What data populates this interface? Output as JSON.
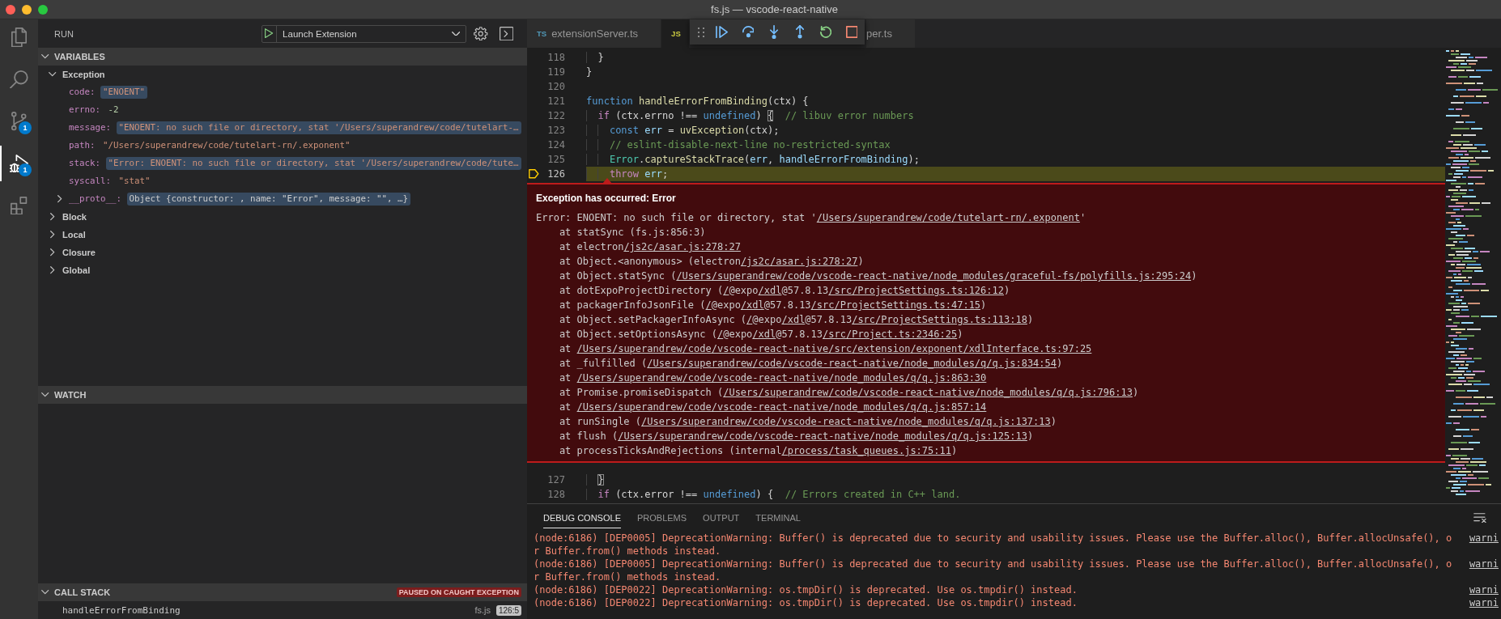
{
  "window": {
    "title": "fs.js — vscode-react-native"
  },
  "activity_bar": {
    "items": [
      {
        "kind": "explorer",
        "selected": false
      },
      {
        "kind": "search",
        "selected": false
      },
      {
        "kind": "source-control",
        "selected": false,
        "badge": "1"
      },
      {
        "kind": "run-debug",
        "selected": true,
        "badge": "1"
      },
      {
        "kind": "extensions",
        "selected": false
      }
    ]
  },
  "sidebar": {
    "title": "RUN",
    "launch_configuration": "Launch Extension",
    "variables": {
      "title": "VARIABLES",
      "expanded": true,
      "scopes": [
        {
          "name": "Exception",
          "expanded": true,
          "variables": [
            {
              "name": "code:",
              "value": "\"ENOENT\"",
              "kind": "string",
              "highlighted": true
            },
            {
              "name": "errno:",
              "value": "-2",
              "kind": "number",
              "highlighted": false
            },
            {
              "name": "message:",
              "value": "\"ENOENT: no such file or directory, stat '/Users/superandrew/code/tutelart-…",
              "kind": "string",
              "highlighted": true
            },
            {
              "name": "path:",
              "value": "\"/Users/superandrew/code/tutelart-rn/.exponent\"",
              "kind": "string",
              "highlighted": false
            },
            {
              "name": "stack:",
              "value": "\"Error: ENOENT: no such file or directory, stat '/Users/superandrew/code/tute…",
              "kind": "string",
              "highlighted": true
            },
            {
              "name": "syscall:",
              "value": "\"stat\"",
              "kind": "string",
              "highlighted": false
            },
            {
              "name": "__proto__:",
              "value": "Object {constructor: , name: \"Error\", message: \"\", …}",
              "kind": "object",
              "expanded": false,
              "highlighted": true
            }
          ]
        },
        {
          "name": "Block",
          "expanded": false
        },
        {
          "name": "Local",
          "expanded": false
        },
        {
          "name": "Closure",
          "expanded": false
        },
        {
          "name": "Global",
          "expanded": false
        }
      ]
    },
    "watch": {
      "title": "WATCH",
      "expanded": true
    },
    "call_stack": {
      "title": "CALL STACK",
      "expanded": true,
      "status": "PAUSED ON CAUGHT EXCEPTION",
      "frames": [
        {
          "name": "handleErrorFromBinding",
          "file": "fs.js",
          "position": "126:5"
        }
      ]
    }
  },
  "debug_toolbar": {
    "buttons": [
      {
        "kind": "grip"
      },
      {
        "kind": "continue"
      },
      {
        "kind": "step-over"
      },
      {
        "kind": "step-into"
      },
      {
        "kind": "step-out"
      },
      {
        "kind": "restart"
      },
      {
        "kind": "stop"
      }
    ]
  },
  "editor": {
    "tabs": [
      {
        "icon": "TS",
        "color": "#519aba",
        "label": "extensionServer.ts",
        "selected": false
      },
      {
        "icon": "JS",
        "color": "#cbcb41",
        "selected": true
      },
      {
        "label": "per.ts",
        "selected": false
      }
    ],
    "lines": [
      {
        "number": "118",
        "current": false,
        "tokens": [
          {
            "text": "  }",
            "kind": "plain"
          }
        ]
      },
      {
        "number": "119",
        "current": false,
        "tokens": [
          {
            "text": "}",
            "kind": "plain"
          }
        ]
      },
      {
        "number": "120",
        "current": false
      },
      {
        "number": "121",
        "current": false,
        "tokens": [
          {
            "text": "function ",
            "kind": "storage"
          },
          {
            "text": "handleErrorFromBinding",
            "kind": "function"
          },
          {
            "text": "(ctx) {",
            "kind": "plain"
          }
        ]
      },
      {
        "number": "122",
        "current": false,
        "tokens": [
          {
            "text": "  if",
            "kind": "keyword"
          },
          {
            "text": " (ctx.errno !== ",
            "kind": "plain"
          },
          {
            "text": "undefined",
            "kind": "storage"
          },
          {
            "text": ") ",
            "kind": "plain"
          },
          {
            "text": "{",
            "kind": "bracket"
          },
          {
            "text": "  // libuv error numbers",
            "kind": "comment"
          }
        ]
      },
      {
        "number": "123",
        "current": false,
        "tokens": [
          {
            "text": "    const ",
            "kind": "storage"
          },
          {
            "text": "err",
            "kind": "variable"
          },
          {
            "text": " = ",
            "kind": "plain"
          },
          {
            "text": "uvException",
            "kind": "function"
          },
          {
            "text": "(ctx);",
            "kind": "plain"
          }
        ]
      },
      {
        "number": "124",
        "current": false,
        "tokens": [
          {
            "text": "    // eslint-disable-next-line no-restricted-syntax",
            "kind": "comment"
          }
        ]
      },
      {
        "number": "125",
        "current": false,
        "tokens": [
          {
            "text": "    Error",
            "kind": "type"
          },
          {
            "text": ".",
            "kind": "plain"
          },
          {
            "text": "captureStackTrace",
            "kind": "function"
          },
          {
            "text": "(",
            "kind": "plain"
          },
          {
            "text": "err",
            "kind": "variable"
          },
          {
            "text": ", ",
            "kind": "plain"
          },
          {
            "text": "handleErrorFromBinding",
            "kind": "variable"
          },
          {
            "text": ");",
            "kind": "plain"
          }
        ]
      },
      {
        "number": "126",
        "current": true,
        "tokens": [
          {
            "text": "    throw ",
            "kind": "keyword"
          },
          {
            "text": "err",
            "kind": "variable"
          },
          {
            "text": ";",
            "kind": "plain"
          }
        ]
      }
    ],
    "exception_widget": {
      "title": "Exception has occurred: Error",
      "lines": [
        {
          "segments": [
            {
              "text": "Error: ENOENT: no such file or directory, stat '",
              "link": false
            },
            {
              "text": "/Users/superandrew/code/tutelart-rn/.exponent",
              "link": true
            },
            {
              "text": "'",
              "link": false
            }
          ]
        },
        {
          "segments": [
            {
              "text": "    at statSync (fs.js:856:3)",
              "link": false
            }
          ]
        },
        {
          "segments": [
            {
              "text": "    at electron",
              "link": false
            },
            {
              "text": "/js2c/asar.js:278:27",
              "link": true
            }
          ]
        },
        {
          "segments": [
            {
              "text": "    at Object.<anonymous> (electron",
              "link": false
            },
            {
              "text": "/js2c/asar.js:278:27",
              "link": true
            },
            {
              "text": ")",
              "link": false
            }
          ]
        },
        {
          "segments": [
            {
              "text": "    at Object.statSync (",
              "link": false
            },
            {
              "text": "/Users/superandrew/code/vscode-react-native/node_modules/graceful-fs/polyfills.js:295:24",
              "link": true
            },
            {
              "text": ")",
              "link": false
            }
          ]
        },
        {
          "segments": [
            {
              "text": "    at dotExpoProjectDirectory (",
              "link": false
            },
            {
              "text": "/",
              "link": true
            },
            {
              "text": "@expo",
              "link": false
            },
            {
              "text": "/xdl",
              "link": true
            },
            {
              "text": "@57.8.13",
              "link": false
            },
            {
              "text": "/src/ProjectSettings.ts:126:12",
              "link": true
            },
            {
              "text": ")",
              "link": false
            }
          ]
        },
        {
          "segments": [
            {
              "text": "    at packagerInfoJsonFile (",
              "link": false
            },
            {
              "text": "/",
              "link": true
            },
            {
              "text": "@expo",
              "link": false
            },
            {
              "text": "/xdl",
              "link": true
            },
            {
              "text": "@57.8.13",
              "link": false
            },
            {
              "text": "/src/ProjectSettings.ts:47:15",
              "link": true
            },
            {
              "text": ")",
              "link": false
            }
          ]
        },
        {
          "segments": [
            {
              "text": "    at Object.setPackagerInfoAsync (",
              "link": false
            },
            {
              "text": "/",
              "link": true
            },
            {
              "text": "@expo",
              "link": false
            },
            {
              "text": "/xdl",
              "link": true
            },
            {
              "text": "@57.8.13",
              "link": false
            },
            {
              "text": "/src/ProjectSettings.ts:113:18",
              "link": true
            },
            {
              "text": ")",
              "link": false
            }
          ]
        },
        {
          "segments": [
            {
              "text": "    at Object.setOptionsAsync (",
              "link": false
            },
            {
              "text": "/",
              "link": true
            },
            {
              "text": "@expo",
              "link": false
            },
            {
              "text": "/xdl",
              "link": true
            },
            {
              "text": "@57.8.13",
              "link": false
            },
            {
              "text": "/src/Project.ts:2346:25",
              "link": true
            },
            {
              "text": ")",
              "link": false
            }
          ]
        },
        {
          "segments": [
            {
              "text": "    at ",
              "link": false
            },
            {
              "text": "/Users/superandrew/code/vscode-react-native/src/extension/exponent/xdlInterface.ts:97:25",
              "link": true
            }
          ]
        },
        {
          "segments": [
            {
              "text": "    at _fulfilled (",
              "link": false
            },
            {
              "text": "/Users/superandrew/code/vscode-react-native/node_modules/q/q.js:834:54",
              "link": true
            },
            {
              "text": ")",
              "link": false
            }
          ]
        },
        {
          "segments": [
            {
              "text": "    at ",
              "link": false
            },
            {
              "text": "/Users/superandrew/code/vscode-react-native/node_modules/q/q.js:863:30",
              "link": true
            }
          ]
        },
        {
          "segments": [
            {
              "text": "    at Promise.promiseDispatch (",
              "link": false
            },
            {
              "text": "/Users/superandrew/code/vscode-react-native/node_modules/q/q.js:796:13",
              "link": true
            },
            {
              "text": ")",
              "link": false
            }
          ]
        },
        {
          "segments": [
            {
              "text": "    at ",
              "link": false
            },
            {
              "text": "/Users/superandrew/code/vscode-react-native/node_modules/q/q.js:857:14",
              "link": true
            }
          ]
        },
        {
          "segments": [
            {
              "text": "    at runSingle (",
              "link": false
            },
            {
              "text": "/Users/superandrew/code/vscode-react-native/node_modules/q/q.js:137:13",
              "link": true
            },
            {
              "text": ")",
              "link": false
            }
          ]
        },
        {
          "segments": [
            {
              "text": "    at flush (",
              "link": false
            },
            {
              "text": "/Users/superandrew/code/vscode-react-native/node_modules/q/q.js:125:13",
              "link": true
            },
            {
              "text": ")",
              "link": false
            }
          ]
        },
        {
          "segments": [
            {
              "text": "    at processTicksAndRejections (internal",
              "link": false
            },
            {
              "text": "/process/task_queues.js:75:11",
              "link": true
            },
            {
              "text": ")",
              "link": false
            }
          ]
        }
      ]
    },
    "lines_after": [
      {
        "number": "127",
        "current": false,
        "tokens": [
          {
            "text": "  }",
            "kind": "bracket"
          }
        ]
      },
      {
        "number": "128",
        "current": false,
        "tokens": [
          {
            "text": "  if",
            "kind": "keyword"
          },
          {
            "text": " (ctx.error !== ",
            "kind": "plain"
          },
          {
            "text": "undefined",
            "kind": "storage"
          },
          {
            "text": ") {",
            "kind": "plain"
          },
          {
            "text": "  // Errors created in C++ land.",
            "kind": "comment"
          }
        ]
      }
    ]
  },
  "panel": {
    "tabs": [
      {
        "label": "DEBUG CONSOLE",
        "selected": true
      },
      {
        "label": "PROBLEMS",
        "selected": false
      },
      {
        "label": "OUTPUT",
        "selected": false
      },
      {
        "label": "TERMINAL",
        "selected": false
      }
    ],
    "messages": [
      {
        "text": "(node:6186) [DEP0005] DeprecationWarning: Buffer() is deprecated due to security and usability issues. Please use the Buffer.alloc(), Buffer.allocUnsafe(), or Buffer.from() methods instead.",
        "source": "warni"
      },
      {
        "text": "(node:6186) [DEP0005] DeprecationWarning: Buffer() is deprecated due to security and usability issues. Please use the Buffer.alloc(), Buffer.allocUnsafe(), or Buffer.from() methods instead.",
        "source": "warni"
      },
      {
        "text": "(node:6186) [DEP0022] DeprecationWarning: os.tmpDir() is deprecated. Use os.tmpdir() instead.",
        "source": "warni"
      },
      {
        "text": "(node:6186) [DEP0022] DeprecationWarning: os.tmpDir() is deprecated. Use os.tmpdir() instead.",
        "source": "warni"
      }
    ]
  }
}
